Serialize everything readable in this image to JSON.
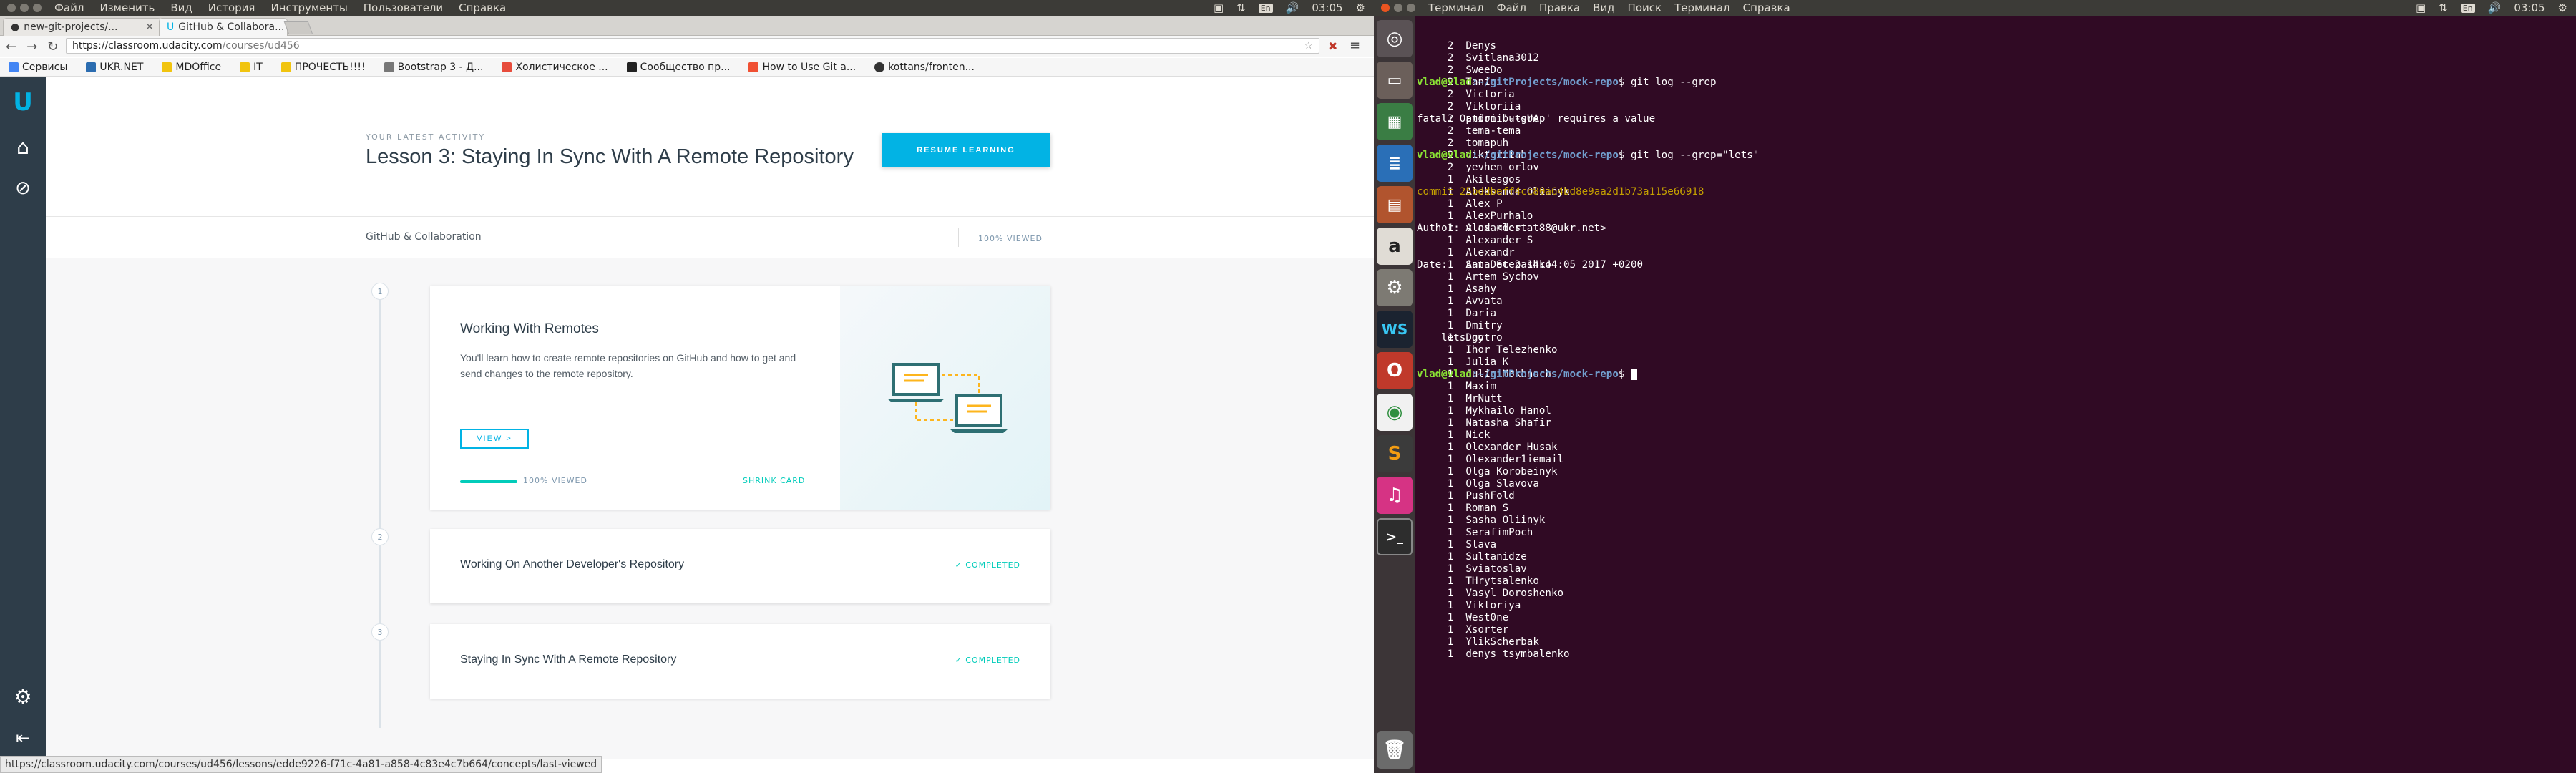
{
  "left_topbar": {
    "menu": [
      "Файл",
      "Изменить",
      "Вид",
      "История",
      "Инструменты",
      "Пользователи",
      "Справка"
    ],
    "lang": "En",
    "time": "03:05"
  },
  "browser": {
    "tabs": [
      {
        "label": "new-git-projects/..."
      },
      {
        "label": "GitHub & Collabora..."
      }
    ],
    "url_host": "https://classroom.udacity.com",
    "url_path": "/courses/ud456",
    "bookmarks": [
      "Сервисы",
      "UKR.NET",
      "MDOffice",
      "IT",
      "ПРОЧЕСТЬ!!!!",
      "Bootstrap 3 - Д...",
      "Холистическое ...",
      "Сообщество пр...",
      "How to Use Git a...",
      "kottans/fronten..."
    ],
    "status_url": "https://classroom.udacity.com/courses/ud456/lessons/edde9226-f71c-4a81-a858-4c83e4c7b664/concepts/last-viewed"
  },
  "udacity": {
    "eyebrow": "YOUR LATEST ACTIVITY",
    "hero_title": "Lesson 3: Staying In Sync With A Remote Repository",
    "resume_label": "RESUME LEARNING",
    "crumb": "GitHub & Collaboration",
    "viewed": "100% VIEWED",
    "lessons": [
      {
        "num": "1",
        "title": "Working With Remotes",
        "desc": "You'll learn how to create remote repositories on GitHub and how to get and send changes to the remote repository.",
        "view_label": "VIEW >",
        "progress_label": "100% VIEWED",
        "progress": 1.0,
        "shrink_label": "SHRINK CARD"
      },
      {
        "num": "2",
        "title": "Working On Another Developer's Repository",
        "status": "✓ COMPLETED"
      },
      {
        "num": "3",
        "title": "Staying In Sync With A Remote Repository",
        "status": "✓ COMPLETED"
      }
    ]
  },
  "right_topbar": {
    "menu": [
      "Терминал",
      "Файл",
      "Правка",
      "Вид",
      "Поиск",
      "Терминал",
      "Справка"
    ],
    "lang": "En",
    "time": "03:05"
  },
  "terminal": {
    "shortlog": [
      [
        "2",
        "Denys"
      ],
      [
        "2",
        "Svitlana3012"
      ],
      [
        "2",
        "SweeDo"
      ],
      [
        "2",
        "Tania"
      ],
      [
        "2",
        "Victoria"
      ],
      [
        "2",
        "Viktoriia"
      ],
      [
        "2",
        "andriibutsUA"
      ],
      [
        "2",
        "tema-tema"
      ],
      [
        "2",
        "tomapuh"
      ],
      [
        "2",
        "viktoriiab"
      ],
      [
        "2",
        "yevhen orlov"
      ],
      [
        "1",
        "Akilesgos"
      ],
      [
        "1",
        "Aleksandr Oliinyk"
      ],
      [
        "1",
        "Alex P"
      ],
      [
        "1",
        "AlexPurhalo"
      ],
      [
        "1",
        "Alexander"
      ],
      [
        "1",
        "Alexander S"
      ],
      [
        "1",
        "Alexandr"
      ],
      [
        "1",
        "Anna Stepashko"
      ],
      [
        "1",
        "Artem Sychov"
      ],
      [
        "1",
        "Asahy"
      ],
      [
        "1",
        "Avvata"
      ],
      [
        "1",
        "Daria"
      ],
      [
        "1",
        "Dmitry"
      ],
      [
        "1",
        "Dnytro"
      ],
      [
        "1",
        "Ihor Telezhenko"
      ],
      [
        "1",
        "Julia K"
      ],
      [
        "1",
        "Julia Mokhnach"
      ],
      [
        "1",
        "Maxim"
      ],
      [
        "1",
        "MrNutt"
      ],
      [
        "1",
        "Mykhailo Hanol"
      ],
      [
        "1",
        "Natasha Shafir"
      ],
      [
        "1",
        "Nick"
      ],
      [
        "1",
        "Olexander Husak"
      ],
      [
        "1",
        "Olexander1iemail"
      ],
      [
        "1",
        "Olga Korobeinyk"
      ],
      [
        "1",
        "Olga Slavova"
      ],
      [
        "1",
        "PushFold"
      ],
      [
        "1",
        "Roman S"
      ],
      [
        "1",
        "Sasha Oliinyk"
      ],
      [
        "1",
        "SerafimPoch"
      ],
      [
        "1",
        "Slava"
      ],
      [
        "1",
        "Sultanidze"
      ],
      [
        "1",
        "Sviatoslav"
      ],
      [
        "1",
        "THrytsalenko"
      ],
      [
        "1",
        "Vasyl Doroshenko"
      ],
      [
        "1",
        "Viktoriya"
      ],
      [
        "1",
        "West0ne"
      ],
      [
        "1",
        "Xsorter"
      ],
      [
        "1",
        "YlikScherbak"
      ],
      [
        "1",
        "denys tsymbalenko"
      ]
    ],
    "prompt_user": "vlad@vlad",
    "prompt_path": ":~/gitProjects/mock-repo",
    "cmd1": "$ git log --grep",
    "err": "fatal: Option '--grep' requires a value",
    "cmd2": "$ git log --grep=\"lets\"",
    "commit": "commit 25bddbeff4cc80a64bd8e9aa2d1b73a115e66918",
    "author": "Author: vlad <lestat88@ukr.net>",
    "date": "Date:   Sat Dec 2 14:44:05 2017 +0200",
    "msg": "    lets go",
    "cmd3": "$ "
  },
  "colors": {
    "udacity_blue": "#02b3e4",
    "udacity_green": "#02ccba",
    "terminal_bg": "#300a24",
    "launcher_bg": "#3c3537"
  }
}
